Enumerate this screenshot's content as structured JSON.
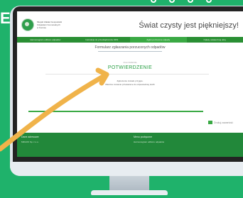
{
  "edge_letter": "E",
  "header": {
    "logo_lines": [
      "Miejski Zakład Gospodarki",
      "Odpadami Komunalnych",
      "w Koninie"
    ],
    "slogan": "Świat czysty jest piękniejszy!"
  },
  "nav": {
    "items": [
      {
        "label": "Harmonogram odbioru odpadów",
        "active": false
      },
      {
        "label": "Instrukcja do przedsiębiorstw ODS",
        "active": false
      },
      {
        "label": "Zgłoś porzucone odpady",
        "active": true
      },
      {
        "label": "Opłaty ostatecznej ulicy",
        "active": false
      }
    ]
  },
  "form": {
    "title": "Formularz zgłaszania porzuconych odpadów",
    "step_label": "ZGŁOSZENIE",
    "step_title": "POTWIERDZENIE",
    "message_1": "Zgłoszenie zostało przyjęte.",
    "message_2": "Wkrótce zostanie przekazane do odpowiedniej służb",
    "progress": 1.0,
    "print_label": "Drukuj zawartość"
  },
  "footer": {
    "left_title": "Dane adresowe",
    "left_line": "MZGOK Sp. z o.o.",
    "right_title": "Menu podręczne",
    "right_line": "Harmonogram odbioru odpadów"
  },
  "colors": {
    "background": "#1fb26b",
    "accent": "#3aa944",
    "arrow": "#f0b34a"
  },
  "icons": [
    "printer-icon",
    "pointer-arrow"
  ]
}
